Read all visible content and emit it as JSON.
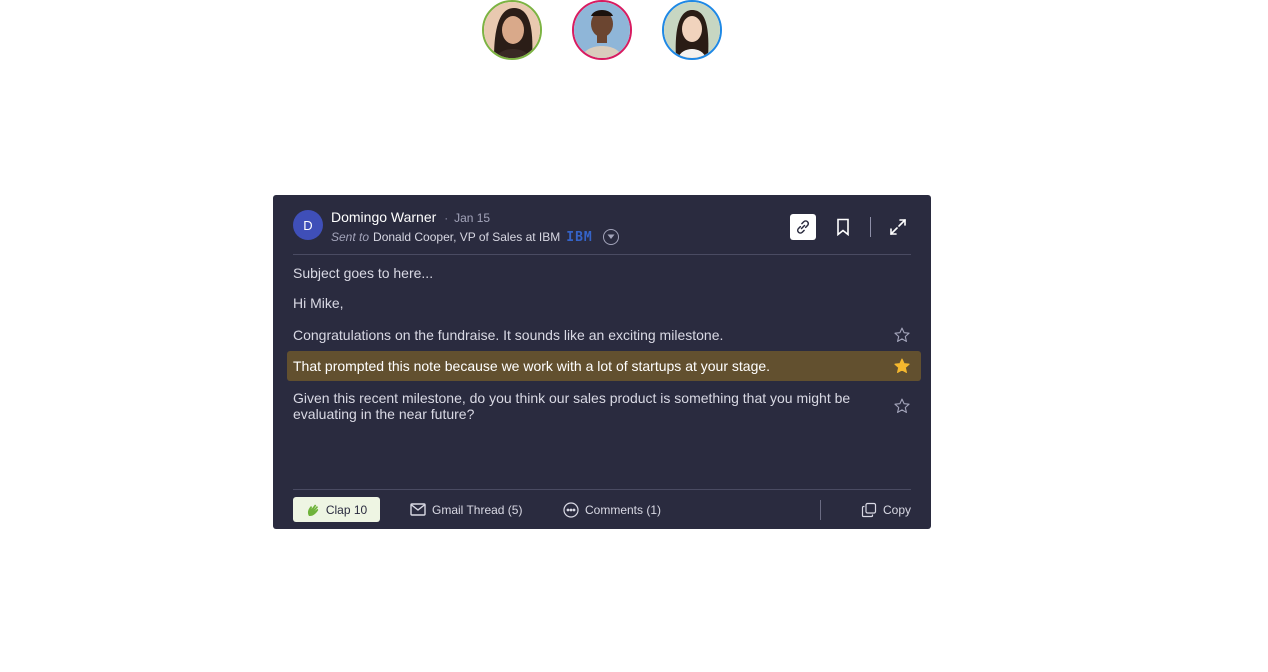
{
  "avatars": [
    {
      "name": "avatar-woman-dark-hair",
      "ring_color": "#7cb342"
    },
    {
      "name": "avatar-man",
      "ring_color": "#d81b60"
    },
    {
      "name": "avatar-woman-asian",
      "ring_color": "#1e88e5"
    }
  ],
  "email": {
    "sender_initial": "D",
    "sender_name": "Domingo Warner",
    "separator": "·",
    "date": "Jan 15",
    "sent_to_prefix": "Sent to",
    "recipient": "Donald Cooper, VP of Sales at IBM",
    "company_logo_text": "IBM",
    "subject": "Subject goes to here...",
    "greeting": "Hi Mike,",
    "lines": [
      {
        "text": "Congratulations on the fundraise. It sounds like an exciting milestone.",
        "starred": false
      },
      {
        "text": "That prompted this note because we work with a lot of startups at your stage.",
        "starred": true
      },
      {
        "text": "Given this recent milestone, do you think our sales product is something that you might be evaluating in the near future?",
        "starred": false
      }
    ]
  },
  "footer": {
    "clap_label": "Clap 10",
    "gmail_label": "Gmail Thread (5)",
    "comments_label": "Comments (1)",
    "copy_label": "Copy"
  },
  "colors": {
    "card_bg": "#2a2b3f",
    "highlight_bg": "#62502f",
    "star_active": "#f5b82e",
    "clap_bg": "#eef5e3",
    "badge_bg": "#3f4fb8"
  },
  "icons": [
    "link-icon",
    "bookmark-icon",
    "expand-icon",
    "chevron-down-icon",
    "star-icon",
    "clap-icon",
    "gmail-icon",
    "comments-icon",
    "copy-icon"
  ]
}
